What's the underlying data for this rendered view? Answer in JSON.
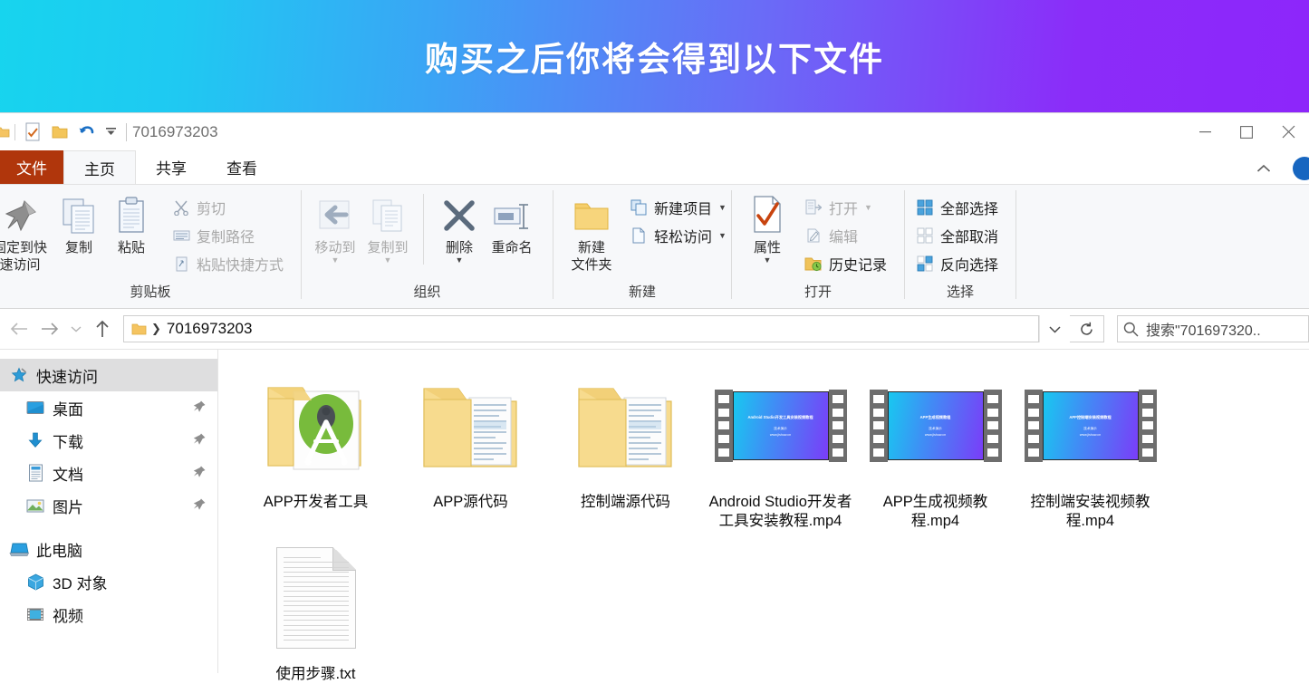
{
  "banner": {
    "title": "购买之后你将会得到以下文件"
  },
  "titlebar": {
    "window_title": "7016973203",
    "qat": [
      {
        "name": "folder-icon",
        "label": "文件夹"
      },
      {
        "name": "properties-icon",
        "label": "属性"
      },
      {
        "name": "new-folder-icon",
        "label": "新建文件夹"
      },
      {
        "name": "undo-icon",
        "label": "撤消"
      },
      {
        "name": "customize-icon",
        "label": "自定义快速访问工具栏"
      }
    ],
    "controls": {
      "minimize": "最小化",
      "maximize": "最大化",
      "close": "关闭"
    }
  },
  "tabs": [
    {
      "label": "文件",
      "type": "file"
    },
    {
      "label": "主页",
      "type": "active"
    },
    {
      "label": "共享",
      "type": "normal"
    },
    {
      "label": "查看",
      "type": "normal"
    }
  ],
  "ribbon": {
    "collapse_label": "折叠功能区",
    "help_label": "帮助",
    "groups": [
      {
        "name": "clipboard",
        "label": "剪贴板",
        "big_buttons": [
          {
            "label": "固定到快\n速访问",
            "icon": "pin-icon",
            "dim": false
          },
          {
            "label": "复制",
            "icon": "copy-icon",
            "dim": false
          },
          {
            "label": "粘贴",
            "icon": "paste-icon",
            "dim": false
          }
        ],
        "small_buttons": [
          {
            "label": "剪切",
            "icon": "scissors-icon",
            "dim": true
          },
          {
            "label": "复制路径",
            "icon": "copy-path-icon",
            "dim": true
          },
          {
            "label": "粘贴快捷方式",
            "icon": "paste-shortcut-icon",
            "dim": true
          }
        ]
      },
      {
        "name": "organize",
        "label": "组织",
        "big_buttons": [
          {
            "label": "移动到",
            "icon": "move-to-icon",
            "dim": true,
            "caret": true
          },
          {
            "label": "复制到",
            "icon": "copy-to-icon",
            "dim": true,
            "caret": true
          },
          {
            "label": "删除",
            "icon": "delete-icon",
            "dim": false,
            "caret": true
          },
          {
            "label": "重命名",
            "icon": "rename-icon",
            "dim": false
          }
        ],
        "small_buttons": []
      },
      {
        "name": "new",
        "label": "新建",
        "big_buttons": [
          {
            "label": "新建\n文件夹",
            "icon": "new-folder-icon",
            "dim": false
          }
        ],
        "small_buttons": [
          {
            "label": "新建项目",
            "icon": "new-item-icon",
            "dim": false,
            "caret": true
          },
          {
            "label": "轻松访问",
            "icon": "easy-access-icon",
            "dim": false,
            "caret": true
          }
        ]
      },
      {
        "name": "open",
        "label": "打开",
        "big_buttons": [
          {
            "label": "属性",
            "icon": "properties-icon",
            "dim": false,
            "caret": true
          }
        ],
        "small_buttons": [
          {
            "label": "打开",
            "icon": "open-icon",
            "dim": true,
            "caret": true
          },
          {
            "label": "编辑",
            "icon": "edit-icon",
            "dim": true
          },
          {
            "label": "历史记录",
            "icon": "history-icon",
            "dim": false
          }
        ]
      },
      {
        "name": "select",
        "label": "选择",
        "big_buttons": [],
        "small_buttons": [
          {
            "label": "全部选择",
            "icon": "select-all-icon",
            "dim": false
          },
          {
            "label": "全部取消",
            "icon": "select-none-icon",
            "dim": false
          },
          {
            "label": "反向选择",
            "icon": "invert-selection-icon",
            "dim": false
          }
        ]
      }
    ]
  },
  "addressbar": {
    "back_label": "后退",
    "forward_label": "前进",
    "recent_label": "最近使用的位置",
    "up_label": "上移到",
    "path_text": "7016973203",
    "dropdown_label": "以前的位置",
    "refresh_label": "刷新",
    "search_placeholder": "搜索\"701697320..",
    "search_value": ""
  },
  "sidebar": {
    "items": [
      {
        "label": "快速访问",
        "icon": "star-pin-icon",
        "selected": true,
        "indent": false,
        "pinned": false
      },
      {
        "label": "桌面",
        "icon": "desktop-icon",
        "selected": false,
        "indent": true,
        "pinned": true
      },
      {
        "label": "下载",
        "icon": "download-icon",
        "selected": false,
        "indent": true,
        "pinned": true
      },
      {
        "label": "文档",
        "icon": "documents-icon",
        "selected": false,
        "indent": true,
        "pinned": true
      },
      {
        "label": "图片",
        "icon": "pictures-icon",
        "selected": false,
        "indent": true,
        "pinned": true
      },
      {
        "label": "此电脑",
        "icon": "this-pc-icon",
        "selected": false,
        "indent": false,
        "pinned": false
      },
      {
        "label": "3D 对象",
        "icon": "3d-objects-icon",
        "selected": false,
        "indent": true,
        "pinned": false
      },
      {
        "label": "视频",
        "icon": "videos-icon",
        "selected": false,
        "indent": true,
        "pinned": false
      }
    ]
  },
  "files": [
    {
      "name": "APP开发者工具",
      "type": "folder-android"
    },
    {
      "name": "APP源代码",
      "type": "folder-docs"
    },
    {
      "name": "控制端源代码",
      "type": "folder-docs"
    },
    {
      "name": "Android Studio开发者工具安装教程.mp4",
      "type": "video",
      "thumb_title": "Android Studio开发工具安装视频教程",
      "thumb_sub1": "技术演示",
      "thumb_sub2": "www.jishuw.cn"
    },
    {
      "name": "APP生成视频教程.mp4",
      "type": "video",
      "thumb_title": "APP生成视频教程",
      "thumb_sub1": "技术演示",
      "thumb_sub2": "www.jishuw.cn"
    },
    {
      "name": "控制端安装视频教程.mp4",
      "type": "video",
      "thumb_title": "APP控制端安装视频教程",
      "thumb_sub1": "技术演示",
      "thumb_sub2": "www.jishuw.cn"
    },
    {
      "name": "使用步骤.txt",
      "type": "text"
    }
  ],
  "colors": {
    "banner_start": "#17d4ee",
    "banner_end": "#8d26fa",
    "file_tab": "#b0360c",
    "ribbon_bg": "#f7f8fa",
    "sidebar_selected": "#dededf",
    "accent_blue": "#1766c0"
  }
}
